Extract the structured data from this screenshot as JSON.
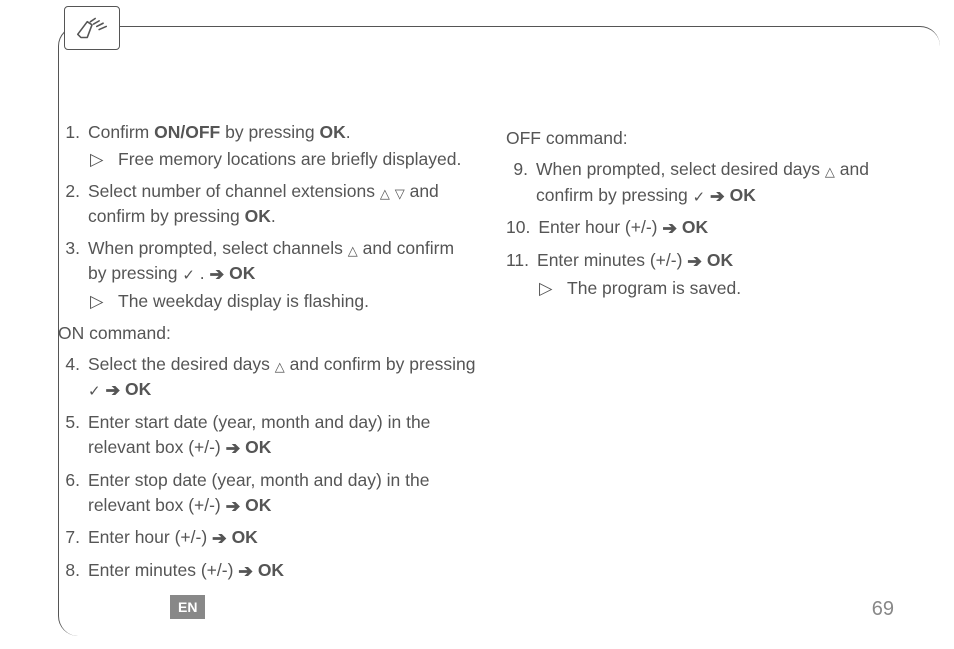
{
  "pageNumber": "69",
  "langBadge": "EN",
  "glyphs": {
    "up": "△",
    "down": "▽",
    "check": "✓",
    "arrow": "➔",
    "result": "▷"
  },
  "left": {
    "items": [
      {
        "n": "1.",
        "parts": [
          "Confirm ",
          {
            "b": "ON/OFF"
          },
          " by pressing ",
          {
            "b": "OK"
          },
          "."
        ],
        "sub": [
          "Free memory locations are briefly displayed."
        ]
      },
      {
        "n": "2.",
        "parts": [
          "Select number of channel extensions ",
          {
            "g": "up"
          },
          " ",
          {
            "g": "down"
          },
          " and confirm by pressing ",
          {
            "b": "OK"
          },
          "."
        ]
      },
      {
        "n": "3.",
        "parts": [
          "When prompted, select channels ",
          {
            "g": "up"
          },
          " and confirm by pressing ",
          {
            "g": "check"
          },
          " . ",
          {
            "g": "arrow"
          },
          " ",
          {
            "b": "OK"
          }
        ],
        "sub": [
          "The weekday display is flashing."
        ]
      }
    ],
    "onLabel": "ON command:",
    "onItems": [
      {
        "n": "4.",
        "parts": [
          "Select the desired days ",
          {
            "g": "up"
          },
          " and confirm by pressing ",
          {
            "g": "check"
          },
          "  ",
          {
            "g": "arrow"
          },
          " ",
          {
            "b": "OK"
          }
        ]
      },
      {
        "n": "5.",
        "parts": [
          "Enter start date (year, month and day) in the relevant box (+/-) ",
          {
            "g": "arrow"
          },
          " ",
          {
            "b": "OK"
          }
        ]
      },
      {
        "n": "6.",
        "parts": [
          "Enter stop date (year, month and day) in the relevant box (+/-) ",
          {
            "g": "arrow"
          },
          " ",
          {
            "b": "OK"
          }
        ]
      },
      {
        "n": "7.",
        "parts": [
          "Enter hour (+/-) ",
          {
            "g": "arrow"
          },
          " ",
          {
            "b": "OK"
          }
        ]
      },
      {
        "n": "8.",
        "parts": [
          "Enter minutes (+/-) ",
          {
            "g": "arrow"
          },
          " ",
          {
            "b": "OK"
          }
        ]
      }
    ]
  },
  "right": {
    "offLabel": "OFF command:",
    "offItems": [
      {
        "n": "9.",
        "parts": [
          "When prompted, select desired days ",
          {
            "g": "up"
          },
          " and confirm by pressing ",
          {
            "g": "check"
          },
          "  ",
          {
            "g": "arrow"
          },
          " ",
          {
            "b": "OK"
          }
        ]
      },
      {
        "n": "10.",
        "parts": [
          "Enter hour (+/-) ",
          {
            "g": "arrow"
          },
          " ",
          {
            "b": "OK"
          }
        ]
      },
      {
        "n": "11.",
        "parts": [
          "Enter minutes (+/-) ",
          {
            "g": "arrow"
          },
          " ",
          {
            "b": "OK"
          }
        ],
        "sub": [
          "The program is saved."
        ]
      }
    ]
  }
}
